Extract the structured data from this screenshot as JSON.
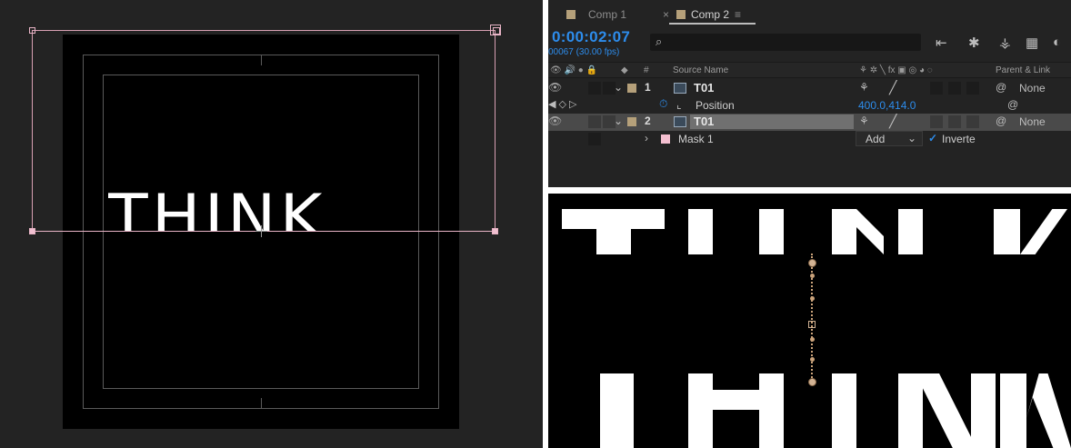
{
  "viewer": {
    "text": "THINK"
  },
  "timeline": {
    "tabs": [
      {
        "label": "Comp 1"
      },
      {
        "label": "Comp 2"
      }
    ],
    "tab_close": "×",
    "tab_menu": "≡",
    "timecode": "0:00:02:07",
    "frame_info": "00067 (30.00 fps)",
    "search_placeholder": "",
    "columns": {
      "number": "#",
      "source_name": "Source Name",
      "parent_link": "Parent & Link"
    },
    "layers": [
      {
        "number": "1",
        "name": "T01",
        "parent": "None"
      },
      {
        "number": "2",
        "name": "T01",
        "parent": "None"
      }
    ],
    "property": {
      "name": "Position",
      "value": "400.0,414.0"
    },
    "mask": {
      "name": "Mask 1",
      "mode": "Add",
      "inverted_label": "Inverte"
    }
  },
  "colors": {
    "timecode": "#2d8ceb",
    "label_tan": "#b5a07a",
    "mask_pink": "#f4bfd0",
    "panel_bg": "#232323"
  }
}
